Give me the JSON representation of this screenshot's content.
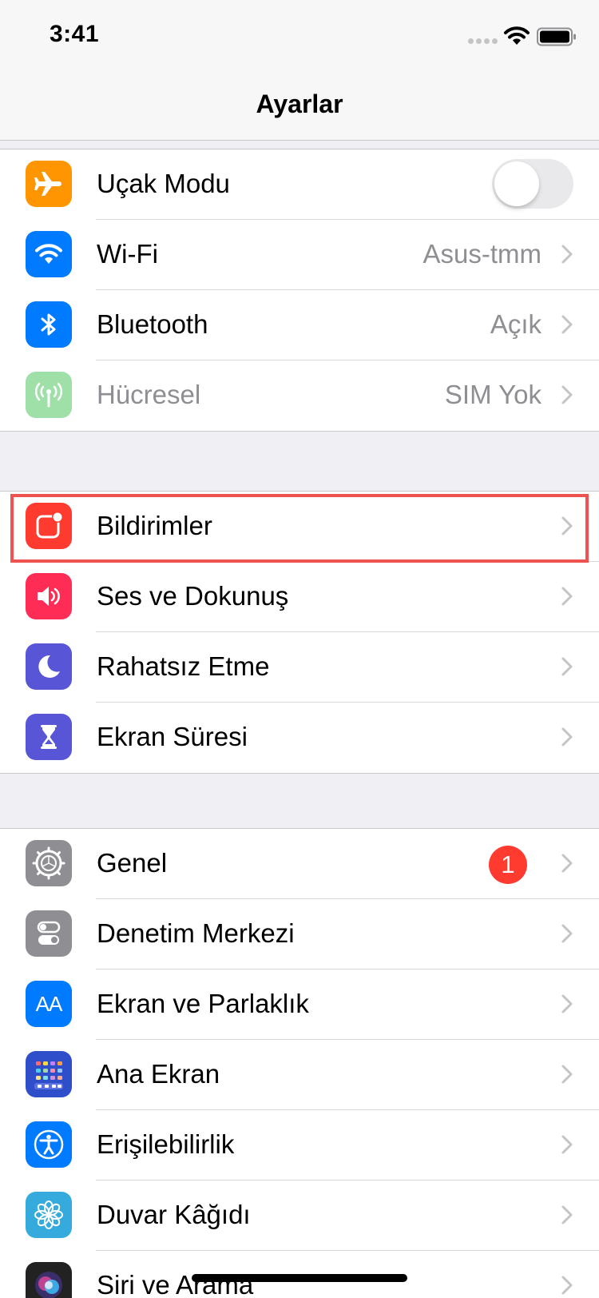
{
  "status_bar": {
    "time": "3:41"
  },
  "nav": {
    "title": "Ayarlar"
  },
  "groups": [
    {
      "rows": [
        {
          "label": "Uçak Modu",
          "icon": "airplane-icon",
          "icon_color": "#ff9500",
          "control": "toggle",
          "toggle_on": false
        },
        {
          "label": "Wi-Fi",
          "icon": "wifi-icon",
          "icon_color": "#007aff",
          "value": "Asus-tmm"
        },
        {
          "label": "Bluetooth",
          "icon": "bluetooth-icon",
          "icon_color": "#007aff",
          "value": "Açık"
        },
        {
          "label": "Hücresel",
          "icon": "cellular-icon",
          "icon_color": "#9fe0a8",
          "value": "SIM Yok",
          "disabled": true
        }
      ]
    },
    {
      "rows": [
        {
          "label": "Bildirimler",
          "icon": "notifications-icon",
          "icon_color": "#ff3b30",
          "highlighted": true
        },
        {
          "label": "Ses ve Dokunuş",
          "icon": "speaker-icon",
          "icon_color": "#ff2d55"
        },
        {
          "label": "Rahatsız Etme",
          "icon": "moon-icon",
          "icon_color": "#5856d6"
        },
        {
          "label": "Ekran Süresi",
          "icon": "hourglass-icon",
          "icon_color": "#5856d6"
        }
      ]
    },
    {
      "rows": [
        {
          "label": "Genel",
          "icon": "gear-icon",
          "icon_color": "#8e8e93",
          "badge": "1"
        },
        {
          "label": "Denetim Merkezi",
          "icon": "control-center-icon",
          "icon_color": "#8e8e93"
        },
        {
          "label": "Ekran ve Parlaklık",
          "icon": "display-brightness-icon",
          "icon_color": "#007aff",
          "icon_text": "AA"
        },
        {
          "label": "Ana Ekran",
          "icon": "home-screen-icon",
          "icon_color": "#2f4ec9"
        },
        {
          "label": "Erişilebilirlik",
          "icon": "accessibility-icon",
          "icon_color": "#007aff"
        },
        {
          "label": "Duvar Kâğıdı",
          "icon": "wallpaper-flower-icon",
          "icon_color": "#35aadc"
        },
        {
          "label": "Siri ve Arama",
          "icon": "siri-icon",
          "icon_color": "#222222"
        }
      ]
    }
  ]
}
